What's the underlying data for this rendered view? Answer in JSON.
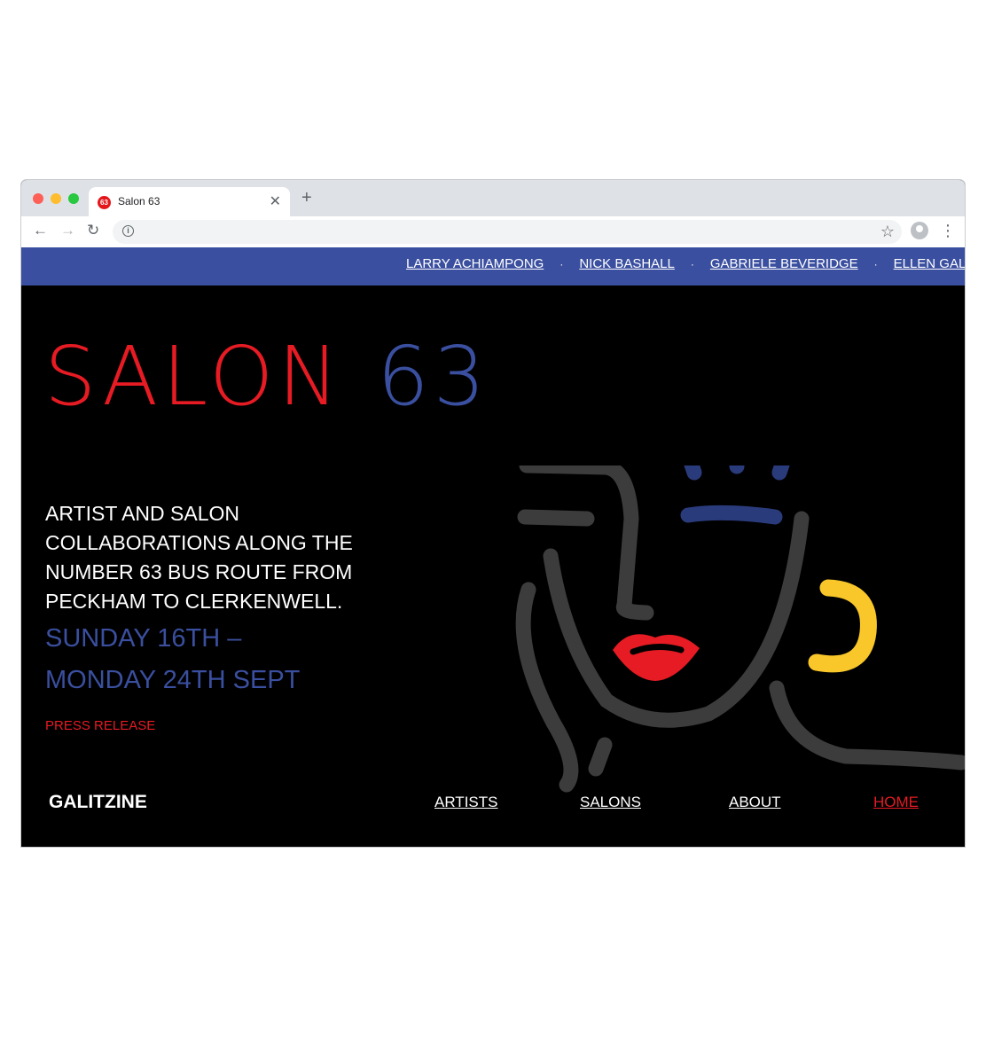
{
  "browser": {
    "tab_title": "Salon 63",
    "favicon_text": "63",
    "close_icon": "close-icon",
    "new_tab_icon": "plus-icon"
  },
  "colors": {
    "brand_red": "#e61b23",
    "brand_blue": "#3a4f9f",
    "accent_yellow": "#f9c72a",
    "line_grey": "#3c3c3c",
    "background": "#000000"
  },
  "artist_bar": {
    "artists": [
      "LARRY ACHIAMPONG",
      "NICK BASHALL",
      "GABRIELE BEVERIDGE",
      "ELLEN GALLAGHER"
    ],
    "separator": "·"
  },
  "hero": {
    "title_word": "SALON",
    "title_number": "63",
    "tagline": "ARTIST AND SALON COLLABORATIONS ALONG THE NUMBER 63 BUS ROUTE FROM PECKHAM TO CLERKENWELL.",
    "dates_line1": "SUNDAY 16TH –",
    "dates_line2": "MONDAY 24TH SEPT",
    "press_link": "PRESS RELEASE"
  },
  "footer": {
    "logo": "GALITZINE",
    "nav": [
      {
        "label": "ARTISTS",
        "active": false
      },
      {
        "label": "SALONS",
        "active": false
      },
      {
        "label": "ABOUT",
        "active": false
      },
      {
        "label": "HOME",
        "active": true
      }
    ]
  }
}
